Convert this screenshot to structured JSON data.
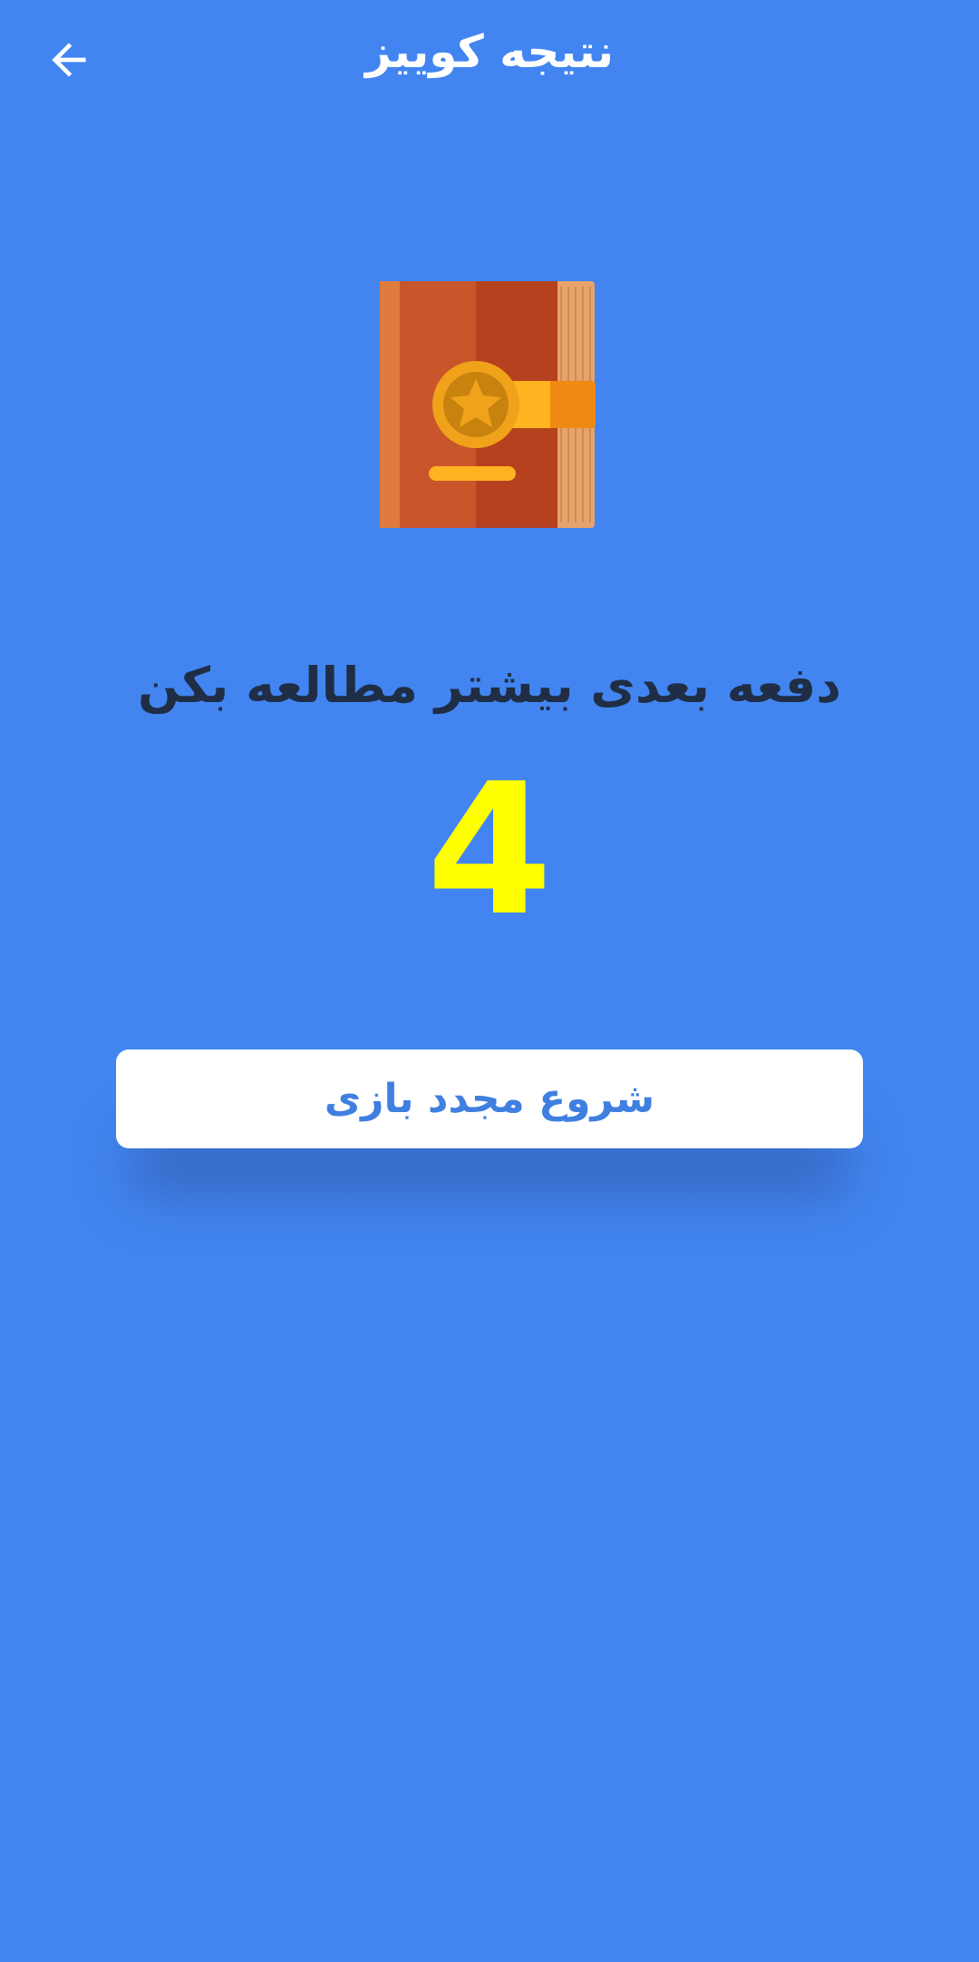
{
  "header": {
    "title": "نتیجه کوییز",
    "back_icon": "arrow-left-icon"
  },
  "illustration": {
    "icon": "book-with-star-badge-icon"
  },
  "result": {
    "message": "دفعه بعدی بیشتر مطالعه بکن",
    "score": "4"
  },
  "actions": {
    "restart_label": "شروع مجدد بازی"
  },
  "colors": {
    "background": "#4285F0",
    "score": "#FFFF00",
    "message_text": "#1F2D45",
    "button_text": "#3F7FE0"
  }
}
